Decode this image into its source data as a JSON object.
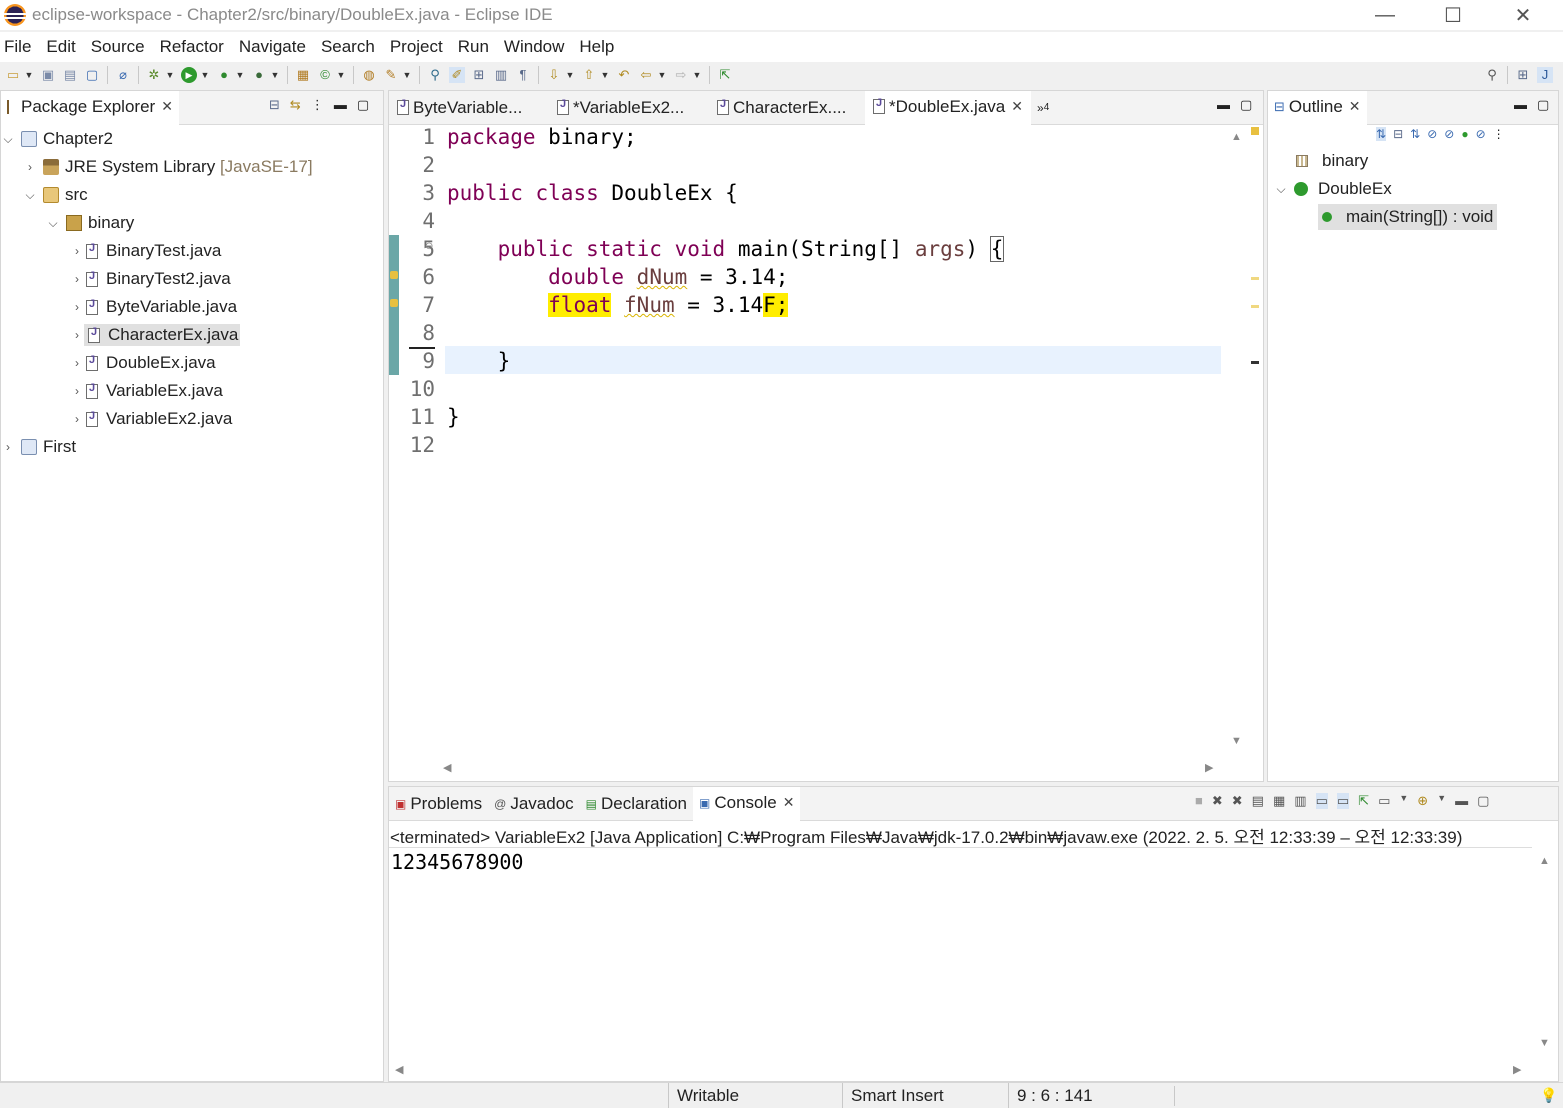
{
  "window": {
    "title": "eclipse-workspace - Chapter2/src/binary/DoubleEx.java - Eclipse IDE",
    "minimize": "—",
    "maximize": "☐",
    "close": "✕"
  },
  "menu": [
    "File",
    "Edit",
    "Source",
    "Refactor",
    "Navigate",
    "Search",
    "Project",
    "Run",
    "Window",
    "Help"
  ],
  "package_explorer": {
    "tab_label": "Package Explorer",
    "tree": [
      {
        "label": "Chapter2",
        "icon": "project-icon",
        "expanded": true
      },
      {
        "label": "JRE System Library",
        "suffix": "[JavaSE-17]",
        "icon": "library-icon"
      },
      {
        "label": "src",
        "icon": "source-folder-icon",
        "expanded": true
      },
      {
        "label": "binary",
        "icon": "package-icon",
        "expanded": true
      },
      {
        "label": "BinaryTest.java",
        "icon": "java-file-icon"
      },
      {
        "label": "BinaryTest2.java",
        "icon": "java-file-icon"
      },
      {
        "label": "ByteVariable.java",
        "icon": "java-file-icon"
      },
      {
        "label": "CharacterEx.java",
        "icon": "java-file-icon",
        "selected": true
      },
      {
        "label": "DoubleEx.java",
        "icon": "java-file-icon"
      },
      {
        "label": "VariableEx.java",
        "icon": "java-file-icon"
      },
      {
        "label": "VariableEx2.java",
        "icon": "java-file-icon"
      },
      {
        "label": "First",
        "icon": "project-icon"
      }
    ]
  },
  "editor": {
    "tabs": [
      {
        "label": "ByteVariable...",
        "active": false
      },
      {
        "label": "*VariableEx2...",
        "active": false
      },
      {
        "label": "CharacterEx....",
        "active": false
      },
      {
        "label": "*DoubleEx.java",
        "active": true
      }
    ],
    "overflow_label": "»",
    "overflow_count": "4",
    "line_numbers": [
      "1",
      "2",
      "3",
      "4",
      "5",
      "6",
      "7",
      "8",
      "9",
      "10",
      "11",
      "12"
    ],
    "code": {
      "l1_kw": "package",
      "l1_rest": " binary;",
      "l3_kw1": "public",
      "l3_kw2": "class",
      "l3_rest": " DoubleEx {",
      "l5_kw1": "public",
      "l5_kw2": "static",
      "l5_kw3": "void",
      "l5_mid": " main(String[] ",
      "l5_arg": "args",
      "l5_end": ") ",
      "l5_brace": "{",
      "l6_kw": "double",
      "l6_var": "dNum",
      "l6_rest": " = 3.14;",
      "l7_kw": "float",
      "l7_var": "fNum",
      "l7_mid": " = 3.14",
      "l7_hl": "F",
      "l7_end": ";",
      "l9": "}",
      "l11": "}"
    },
    "current_line": 9
  },
  "outline": {
    "tab_label": "Outline",
    "items": [
      {
        "label": "binary",
        "icon": "package-icon"
      },
      {
        "label": "DoubleEx",
        "icon": "class-icon"
      },
      {
        "label": "main(String[]) : void",
        "icon": "method-icon",
        "selected": true
      }
    ]
  },
  "bottom": {
    "tabs": [
      "Problems",
      "Javadoc",
      "Declaration",
      "Console"
    ],
    "active_tab": "Console",
    "console_header": "<terminated> VariableEx2 [Java Application] C:₩Program Files₩Java₩jdk-17.0.2₩bin₩javaw.exe  (2022. 2. 5. 오전 12:33:39 – 오전 12:33:39)",
    "console_output": "12345678900"
  },
  "status": {
    "writable": "Writable",
    "insert_mode": "Smart Insert",
    "position": "9 : 6 : 141"
  }
}
